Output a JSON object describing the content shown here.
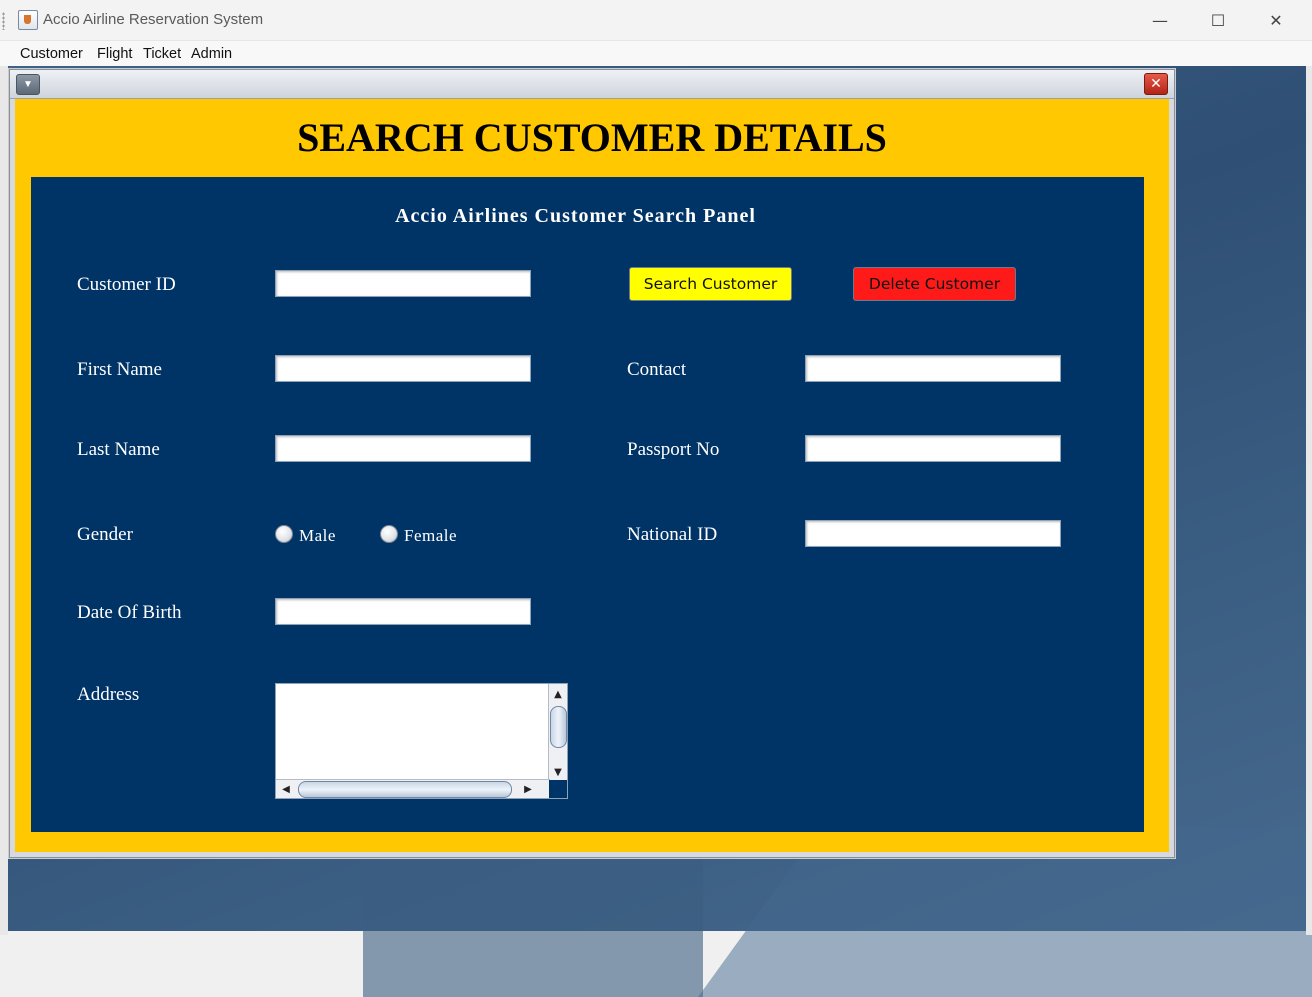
{
  "window": {
    "title": "Accio Airline Reservation System",
    "controls": {
      "minimize": "—",
      "maximize": "☐",
      "close": "✕"
    }
  },
  "menubar": {
    "items": [
      "Customer",
      "Flight",
      "Ticket",
      "Admin"
    ]
  },
  "internal_frame": {
    "system_menu_icon": "▼",
    "close_icon": "✕"
  },
  "page": {
    "title": "SEARCH CUSTOMER DETAILS",
    "panel_title": "Accio Airlines Customer Search Panel"
  },
  "form": {
    "customer_id_label": "Customer ID",
    "first_name_label": "First Name",
    "last_name_label": "Last Name",
    "gender_label": "Gender",
    "dob_label": "Date Of Birth",
    "address_label": "Address",
    "contact_label": "Contact",
    "passport_label": "Passport No",
    "national_id_label": "National ID",
    "gender_options": [
      "Male",
      "Female"
    ],
    "values": {
      "customer_id": "",
      "first_name": "",
      "last_name": "",
      "dob": "",
      "address": "",
      "contact": "",
      "passport": "",
      "national_id": ""
    }
  },
  "buttons": {
    "search": "Search Customer",
    "delete": "Delete Customer"
  },
  "colors": {
    "header_bg": "#ffc800",
    "panel_bg": "#003366",
    "search_button": "#ffff00",
    "delete_button": "#ff1a1a"
  }
}
